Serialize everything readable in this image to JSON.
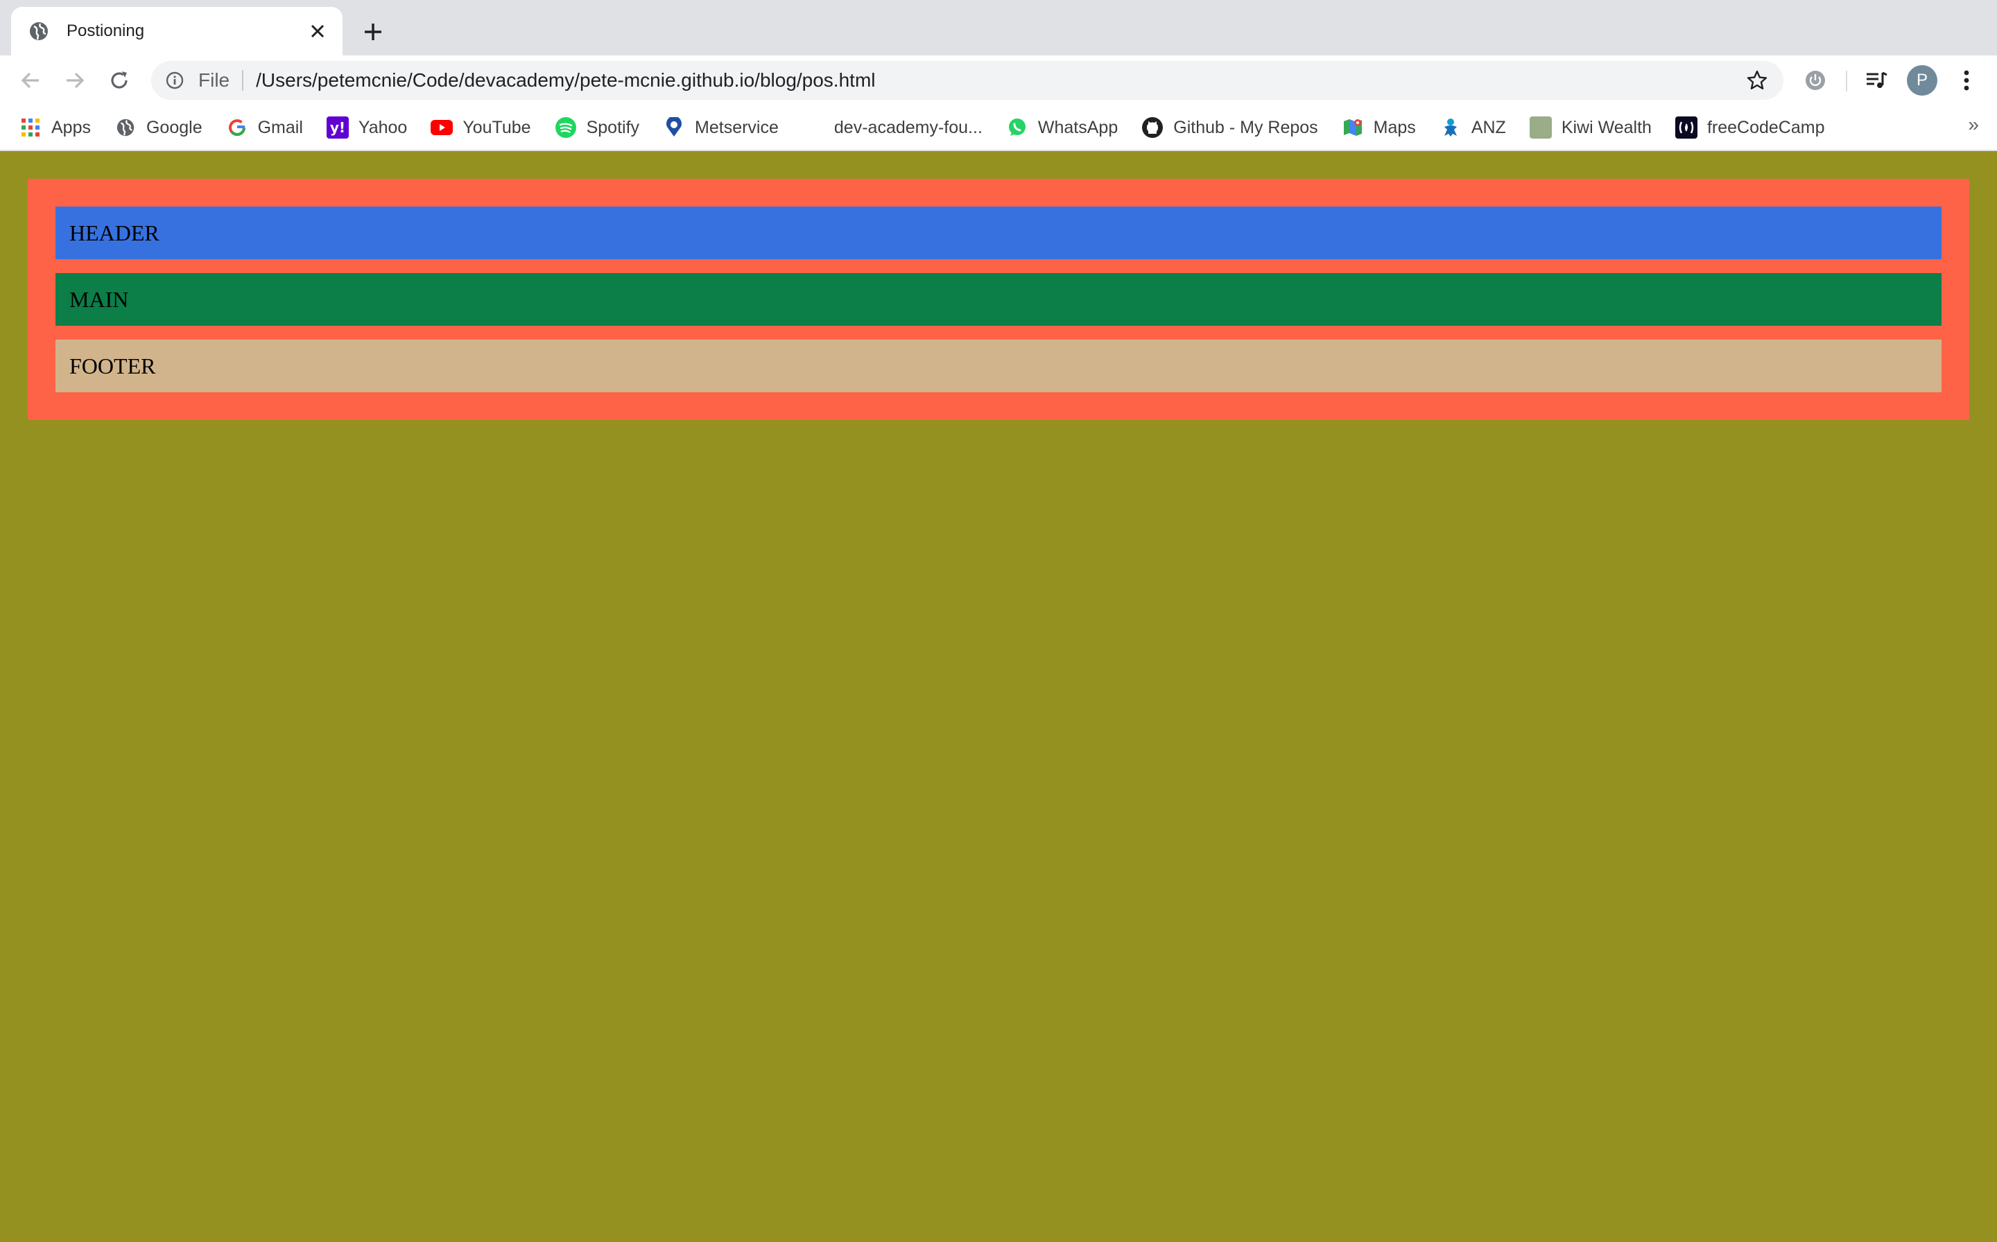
{
  "tab": {
    "title": "Postioning",
    "favicon": "globe-icon"
  },
  "toolbar": {
    "scheme": "File",
    "url": "/Users/petemcnie/Code/devacademy/pete-mcnie.github.io/blog/pos.html",
    "avatar_letter": "P"
  },
  "bookmarks": [
    {
      "label": "Apps",
      "icon": "apps-grid-icon"
    },
    {
      "label": "Google",
      "icon": "globe-icon"
    },
    {
      "label": "Gmail",
      "icon": "google-g-icon"
    },
    {
      "label": "Yahoo",
      "icon": "yahoo-icon"
    },
    {
      "label": "YouTube",
      "icon": "youtube-icon"
    },
    {
      "label": "Spotify",
      "icon": "spotify-icon"
    },
    {
      "label": "Metservice",
      "icon": "metservice-icon"
    },
    {
      "label": "dev-academy-fou...",
      "icon": "blank-icon"
    },
    {
      "label": "WhatsApp",
      "icon": "whatsapp-icon"
    },
    {
      "label": "Github - My Repos",
      "icon": "github-icon"
    },
    {
      "label": "Maps",
      "icon": "maps-icon"
    },
    {
      "label": "ANZ",
      "icon": "anz-icon"
    },
    {
      "label": "Kiwi Wealth",
      "icon": "kiwi-wealth-icon"
    },
    {
      "label": "freeCodeCamp",
      "icon": "freecodecamp-icon"
    }
  ],
  "bookmarks_more": "»",
  "page": {
    "background": "#949120",
    "container_color": "#ff6347",
    "header": {
      "label": "HEADER",
      "color": "#3771e0"
    },
    "main": {
      "label": "MAIN",
      "color": "#0c7e48"
    },
    "footer": {
      "label": "FOOTER",
      "color": "#d2b48c"
    }
  }
}
